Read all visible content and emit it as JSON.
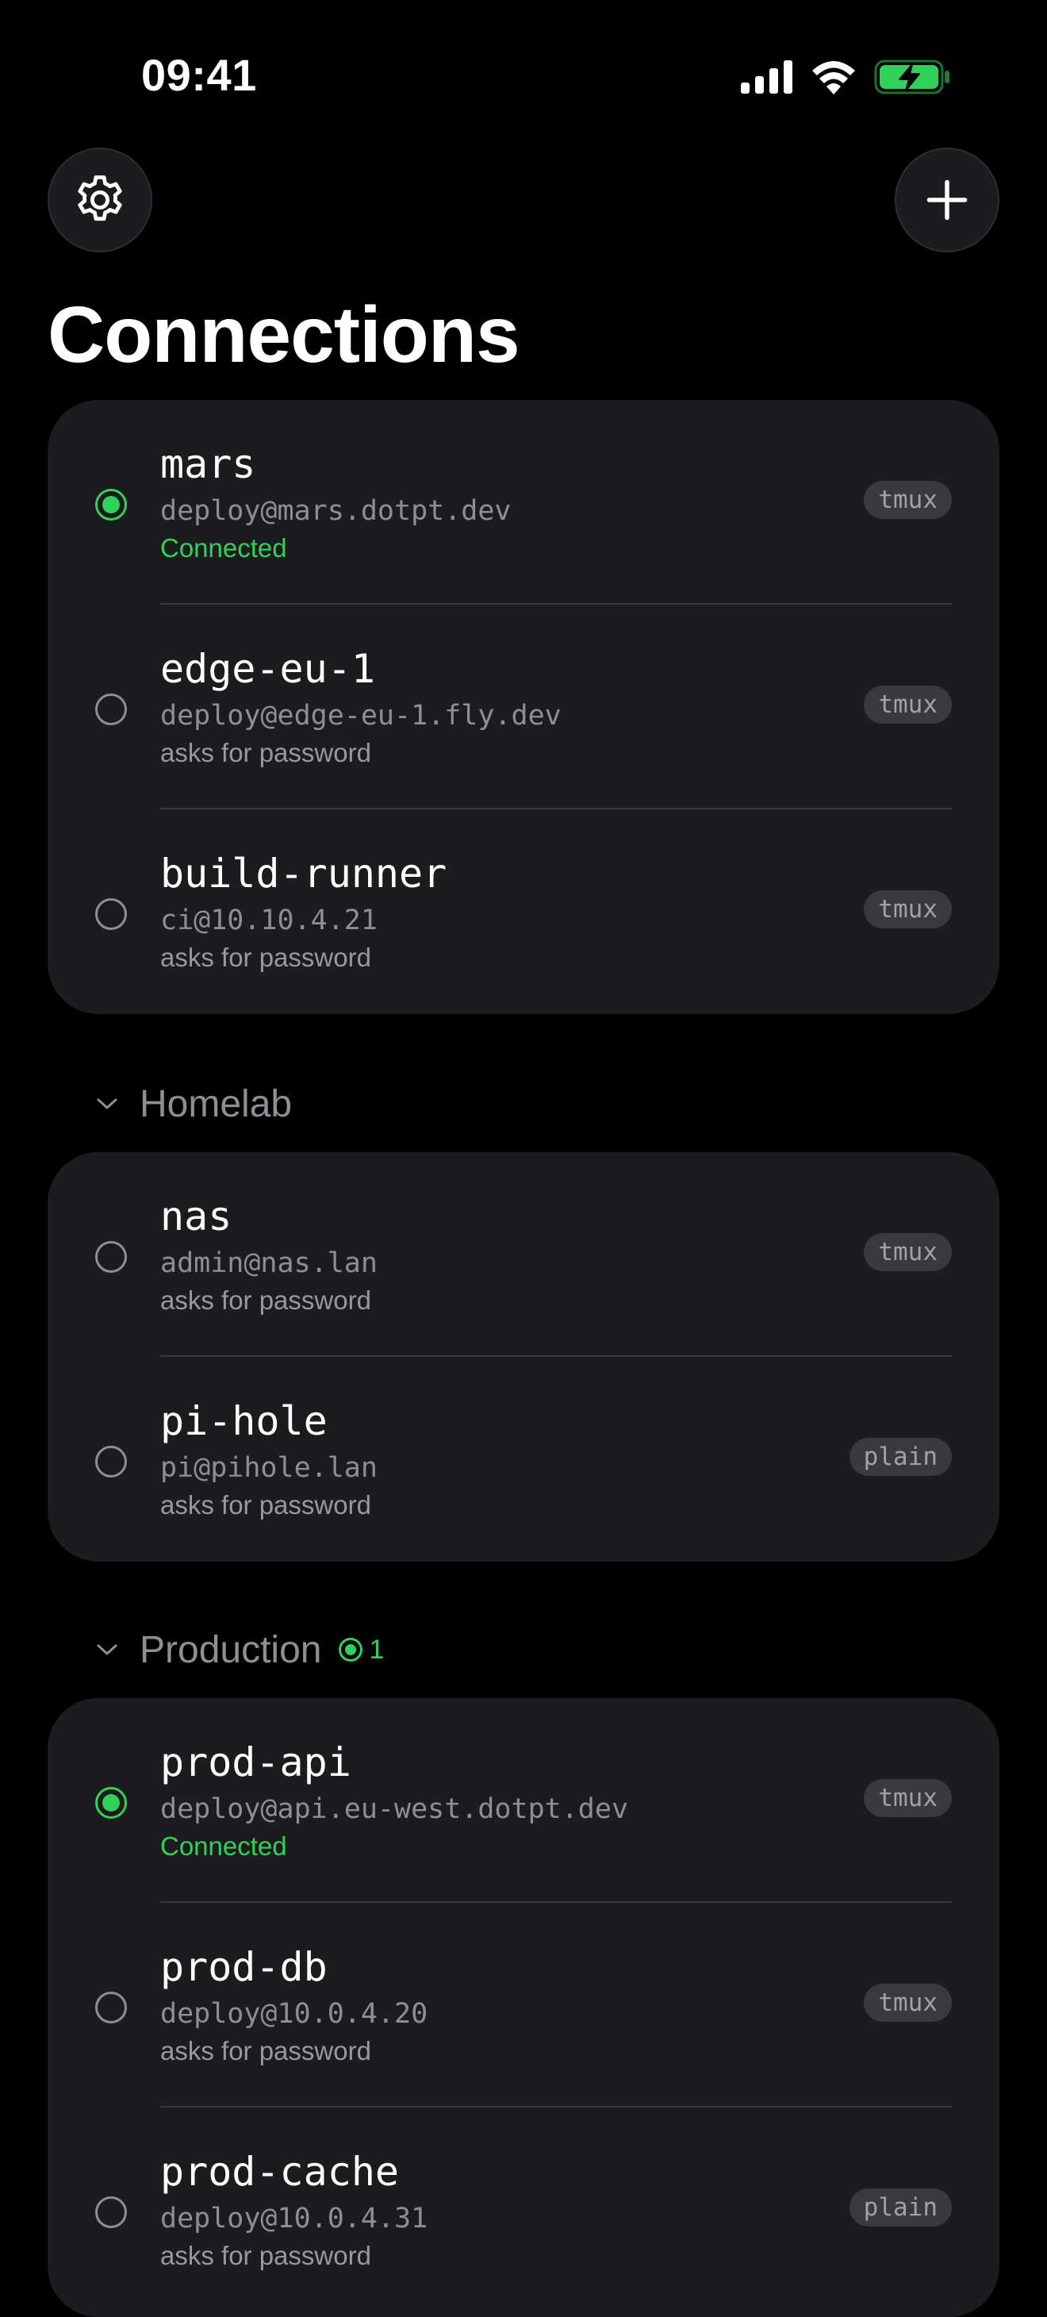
{
  "status_bar": {
    "time": "09:41",
    "signal_icon": "cellular-signal-icon",
    "wifi_icon": "wifi-icon",
    "battery_icon": "battery-charging-icon",
    "battery_color": "#30d158"
  },
  "header": {
    "settings_icon": "gear-icon",
    "add_icon": "plus-icon",
    "title": "Connections"
  },
  "colors": {
    "background": "#000000",
    "card": "#1c1c1e",
    "accent_connected": "#30d158",
    "secondary_text": "#8e8e93",
    "tag_background": "#3a3a3c"
  },
  "ungrouped": [
    {
      "name": "mars",
      "address": "deploy@mars.dotpt.dev",
      "status": "Connected",
      "connected": true,
      "tag": "tmux"
    },
    {
      "name": "edge-eu-1",
      "address": "deploy@edge-eu-1.fly.dev",
      "status": "asks for password",
      "connected": false,
      "tag": "tmux"
    },
    {
      "name": "build-runner",
      "address": "ci@10.10.4.21",
      "status": "asks for password",
      "connected": false,
      "tag": "tmux"
    }
  ],
  "groups": [
    {
      "label": "Homelab",
      "expanded": true,
      "connected_count": null,
      "hosts": [
        {
          "name": "nas",
          "address": "admin@nas.lan",
          "status": "asks for password",
          "connected": false,
          "tag": "tmux"
        },
        {
          "name": "pi-hole",
          "address": "pi@pihole.lan",
          "status": "asks for password",
          "connected": false,
          "tag": "plain"
        }
      ]
    },
    {
      "label": "Production",
      "expanded": true,
      "connected_count": "1",
      "hosts": [
        {
          "name": "prod-api",
          "address": "deploy@api.eu-west.dotpt.dev",
          "status": "Connected",
          "connected": true,
          "tag": "tmux"
        },
        {
          "name": "prod-db",
          "address": "deploy@10.0.4.20",
          "status": "asks for password",
          "connected": false,
          "tag": "tmux"
        },
        {
          "name": "prod-cache",
          "address": "deploy@10.0.4.31",
          "status": "asks for password",
          "connected": false,
          "tag": "plain"
        }
      ]
    }
  ]
}
